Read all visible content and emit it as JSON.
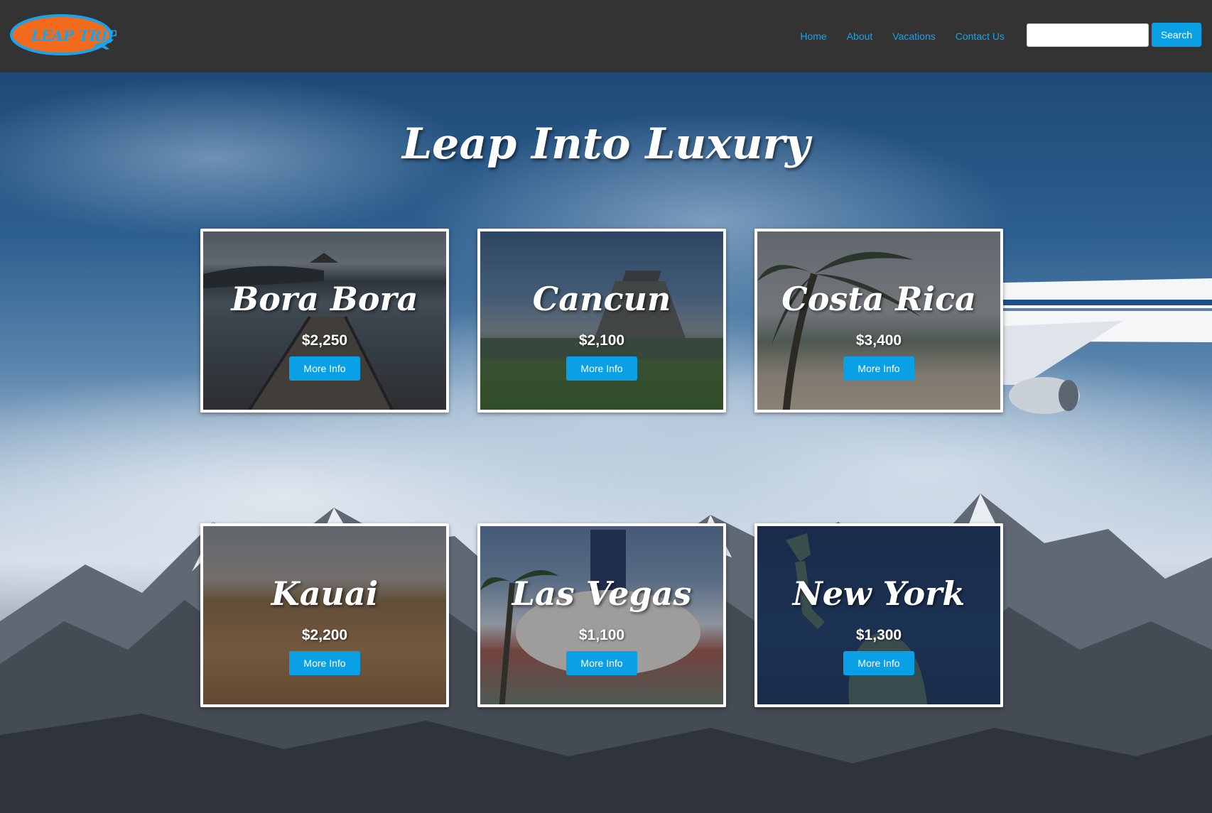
{
  "brand": {
    "logo_text": "LEAP TRIP"
  },
  "nav": {
    "links": [
      {
        "label": "Home"
      },
      {
        "label": "About"
      },
      {
        "label": "Vacations"
      },
      {
        "label": "Contact Us"
      }
    ]
  },
  "search": {
    "value": "",
    "placeholder": "",
    "button_label": "Search"
  },
  "hero": {
    "title": "Leap Into Luxury"
  },
  "cards": [
    {
      "name": "Bora Bora",
      "price": "$2,250",
      "button_label": "More Info"
    },
    {
      "name": "Cancun",
      "price": "$2,100",
      "button_label": "More Info"
    },
    {
      "name": "Costa Rica",
      "price": "$3,400",
      "button_label": "More Info"
    },
    {
      "name": "Kauai",
      "price": "$2,200",
      "button_label": "More Info"
    },
    {
      "name": "Las Vegas",
      "price": "$1,100",
      "button_label": "More Info"
    },
    {
      "name": "New York",
      "price": "$1,300",
      "button_label": "More Info"
    }
  ],
  "colors": {
    "navbar": "#333333",
    "accent": "#0aa0e6",
    "link": "#1aa3e8",
    "logo_fill": "#f26a1b",
    "logo_ring": "#1aa3e8"
  }
}
